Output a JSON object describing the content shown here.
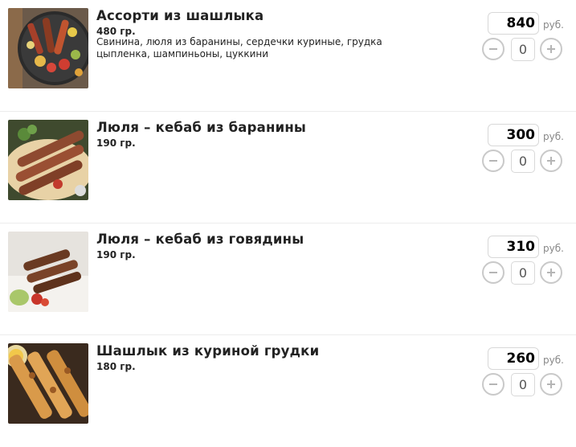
{
  "currency_label": "руб.",
  "items": [
    {
      "title": "Ассорти из шашлыка",
      "weight": "480 гр.",
      "description": "Свинина, люля из баранины, сердечки куриные, грудка цыпленка, шампиньоны, цуккини",
      "price": "840",
      "quantity": "0"
    },
    {
      "title": "Люля – кебаб из баранины",
      "weight": "190 гр.",
      "description": "",
      "price": "300",
      "quantity": "0"
    },
    {
      "title": "Люля – кебаб из говядины",
      "weight": "190 гр.",
      "description": "",
      "price": "310",
      "quantity": "0"
    },
    {
      "title": "Шашлык из куриной грудки",
      "weight": "180 гр.",
      "description": "",
      "price": "260",
      "quantity": "0"
    }
  ]
}
